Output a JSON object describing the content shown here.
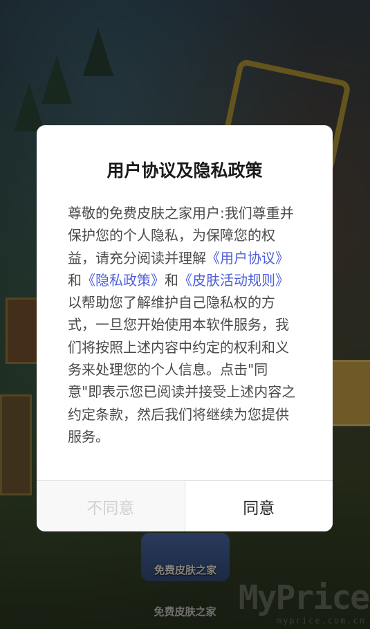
{
  "background": {
    "app_icon_label": "免费皮肤之家",
    "app_name": "免费皮肤之家",
    "watermark": "MyPrice",
    "watermark_sub": "myprice.com.cn"
  },
  "dialog": {
    "title": "用户协议及隐私政策",
    "body_segments": [
      {
        "text": "尊敬的免费皮肤之家用户:我们尊重并保护您的个人隐私，为保障您的权益，请充分阅读并理解",
        "link": false
      },
      {
        "text": "《用户协议》",
        "link": true
      },
      {
        "text": "和",
        "link": false
      },
      {
        "text": "《隐私政策》",
        "link": true
      },
      {
        "text": "和",
        "link": false
      },
      {
        "text": "《皮肤活动规则》",
        "link": true
      },
      {
        "text": "以帮助您了解维护自己隐私权的方式，一旦您开始使用本软件服务，我们将按照上述内容中约定的权利和义务来处理您的个人信息。点击\"同意\"即表示您已阅读并接受上述内容之约定条款，然后我们将继续为您提供服务。",
        "link": false
      }
    ],
    "disagree_label": "不同意",
    "agree_label": "同意",
    "link_color": "#4d5fdc"
  }
}
